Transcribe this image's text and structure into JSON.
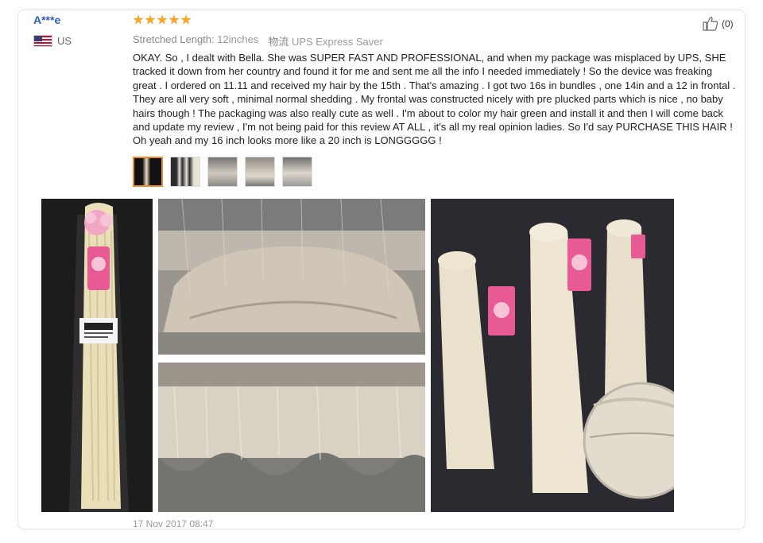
{
  "reviewer": {
    "name": "A***e",
    "country": "US"
  },
  "rating": {
    "stars": 5,
    "color": "#f7a525"
  },
  "meta": {
    "length_label": "Stretched Length:",
    "length_value": "12inches",
    "shipping_label": "物流",
    "shipping_value": "UPS Express Saver"
  },
  "helpful": {
    "count": "(0)",
    "icon": "thumbs-up-icon"
  },
  "review_text": "OKAY. So , I dealt with Bella. She was SUPER FAST AND PROFESSIONAL, and when my package was misplaced by UPS, SHE tracked it down from her country and found it for me and sent me all the info I needed immediately ! So the device was freaking great . I ordered on 11.11 and received my hair by the 15th . That's amazing . I got two 16s in bundles , one 14in and a 12 in frontal . They are all very soft , minimal normal shedding . My frontal was constructed nicely with pre plucked parts which is nice , no baby hairs though ! The packaging was also really cute as well . I'm about to color my hair green and install it and then I will come back and update my review , I'm not being paid for this review AT ALL , it's all my real opinion ladies. So I'd say PURCHASE THIS HAIR ! Oh yeah and my 16 inch looks more like a 20 inch is LONGGGGG !",
  "thumbnails": {
    "count": 5,
    "active_index": 0,
    "active_color": "#f08a22"
  },
  "date": "17 Nov 2017 08:47"
}
